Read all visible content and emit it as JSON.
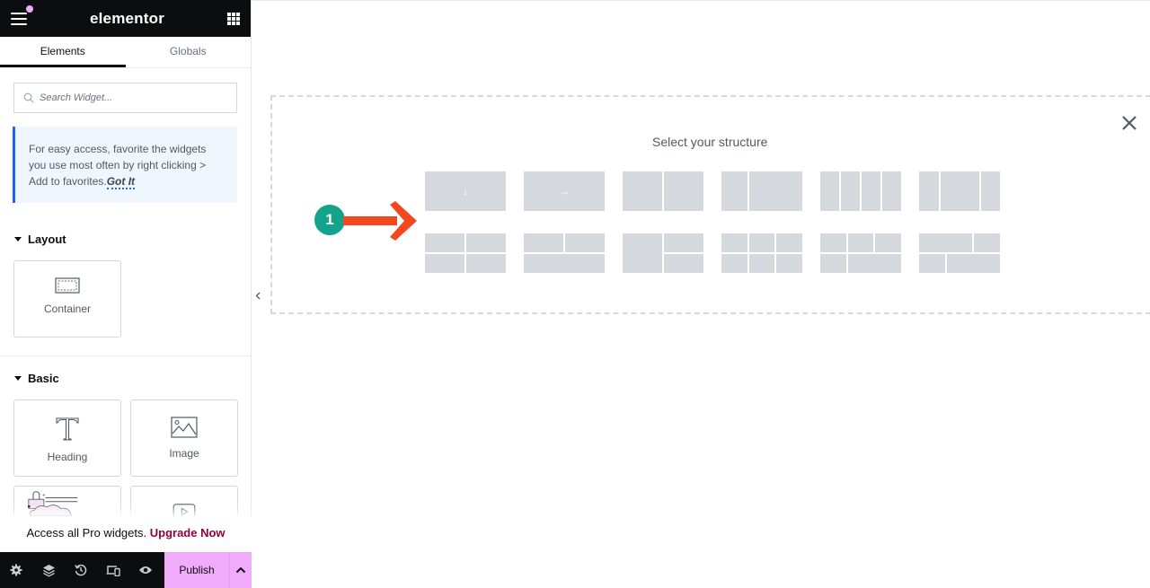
{
  "app": {
    "logo": "elementor"
  },
  "tabs": [
    {
      "label": "Elements",
      "active": true
    },
    {
      "label": "Globals",
      "active": false
    }
  ],
  "search": {
    "placeholder": "Search Widget..."
  },
  "notice": {
    "text": "For easy access, favorite the widgets you use most often by right clicking > Add to favorites.",
    "link": "Got It"
  },
  "sections": {
    "layout": {
      "title": "Layout",
      "widgets": [
        {
          "label": "Container",
          "icon": "container-icon"
        }
      ]
    },
    "basic": {
      "title": "Basic",
      "widgets": [
        {
          "label": "Heading",
          "icon": "heading-icon"
        },
        {
          "label": "Image",
          "icon": "image-icon"
        },
        {
          "label": "",
          "icon": "text-editor-icon"
        },
        {
          "label": "",
          "icon": "video-icon"
        }
      ]
    }
  },
  "promo": {
    "text": "Access all Pro widgets. ",
    "link": "Upgrade Now"
  },
  "footer": {
    "icons": [
      "settings-icon",
      "layers-icon",
      "history-icon",
      "responsive-icon",
      "preview-icon"
    ],
    "publish_label": "Publish"
  },
  "canvas": {
    "structure_title": "Select your structure",
    "annotation_number": "1",
    "presets_row1": [
      "flexbox-column",
      "flexbox-row",
      "two-columns",
      "one-third-two-thirds",
      "four-columns",
      "quarter-half-quarter"
    ],
    "presets_row2": [
      "grid-2x2",
      "two-over-one",
      "one-beside-two-stacked",
      "grid-3x2",
      "three-over-one-plus-two",
      "two-over-two-offset"
    ]
  },
  "colors": {
    "accent_pink": "#f0abfc",
    "upgrade": "#93003f",
    "notice_border": "#2563eb",
    "badge_green": "#12a38a",
    "arrow_orange": "#f4461f"
  }
}
